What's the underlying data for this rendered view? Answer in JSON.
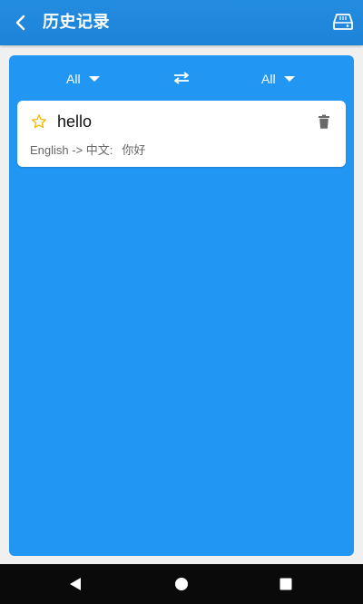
{
  "header": {
    "title": "历史记录",
    "back_icon": "chevron-left-icon",
    "action_icon": "disk-icon",
    "background": "#1d83d8"
  },
  "panel": {
    "background": "#2196f3",
    "from_language": "All",
    "to_language": "All",
    "swap_icon": "swap-arrows-icon"
  },
  "history": [
    {
      "word": "hello",
      "direction": "English -> 中文:",
      "translation": "你好",
      "starred": false,
      "star_color": "#f5b800"
    }
  ],
  "system_nav": {
    "back_icon": "triangle-back-icon",
    "home_icon": "circle-home-icon",
    "recent_icon": "square-recent-icon"
  }
}
